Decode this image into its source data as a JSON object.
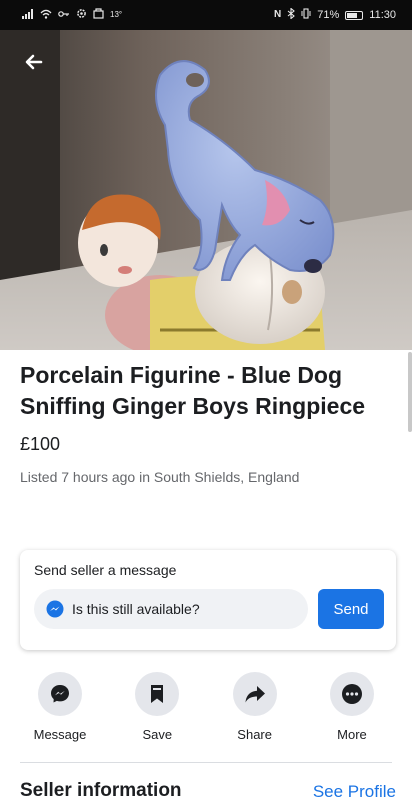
{
  "status_bar": {
    "left_icons": [
      "signal-icon",
      "wifi-icon",
      "key-icon",
      "settings-icon",
      "screenshot-icon"
    ],
    "temperature": "13°",
    "battery_percent": "71%",
    "time": "11:30"
  },
  "photo": {
    "back_icon": "arrow-left-icon"
  },
  "listing": {
    "title": "Porcelain Figurine - Blue Dog Sniffing Ginger Boys Ringpiece",
    "price": "£100",
    "meta": "Listed 7 hours ago in South Shields, England"
  },
  "message_card": {
    "title": "Send seller a message",
    "input_value": "Is this still available?",
    "send_label": "Send"
  },
  "actions": [
    {
      "label": "Message",
      "icon": "messenger-icon"
    },
    {
      "label": "Save",
      "icon": "bookmark-icon"
    },
    {
      "label": "Share",
      "icon": "share-arrow-icon"
    },
    {
      "label": "More",
      "icon": "more-dots-icon"
    }
  ],
  "seller": {
    "heading": "Seller information",
    "see_profile": "See Profile"
  },
  "colors": {
    "accent": "#1b74e4",
    "text": "#1c1e21",
    "secondary_text": "#65676b",
    "chip_bg": "#e4e6eb"
  }
}
